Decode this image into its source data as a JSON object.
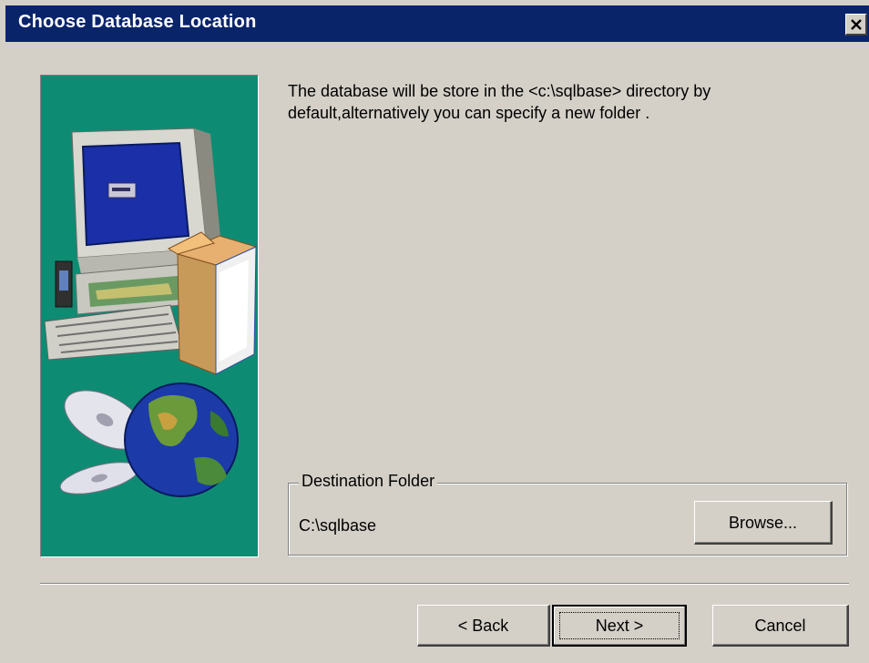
{
  "window": {
    "title": "Choose Database Location",
    "close_icon": "close-icon"
  },
  "content": {
    "intro_text": "The database will be store in the <c:\\sqlbase> directory by\ndefault,alternatively you can specify a new folder ."
  },
  "destination": {
    "group_label": "Destination Folder",
    "path": "C:\\sqlbase",
    "browse_label": "Browse..."
  },
  "footer": {
    "back_label": "< Back",
    "next_label": "Next >",
    "cancel_label": "Cancel"
  },
  "colors": {
    "titlebar": "#0a246a",
    "dialog_bg": "#d4d0c8",
    "art_bg": "#0e8c73"
  }
}
